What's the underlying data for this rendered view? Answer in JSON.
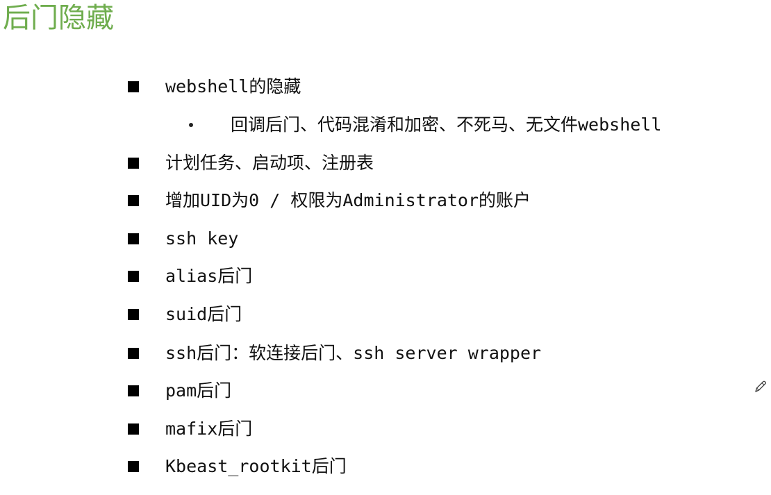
{
  "slide": {
    "title": "后门隐藏",
    "items": [
      {
        "text": "webshell的隐藏"
      },
      {
        "text": "计划任务、启动项、注册表"
      },
      {
        "text": "增加UID为0 / 权限为Administrator的账户"
      },
      {
        "text": "ssh key"
      },
      {
        "text": "alias后门"
      },
      {
        "text": "suid后门"
      },
      {
        "text": "ssh后门：软连接后门、ssh server wrapper"
      },
      {
        "text": "pam后门"
      },
      {
        "text": "mafix后门"
      },
      {
        "text": "Kbeast_rootkit后门"
      }
    ],
    "subitems": [
      {
        "text": "回调后门、代码混淆和加密、不死马、无文件webshell"
      }
    ]
  },
  "icons": {
    "edit": "pencil-icon"
  },
  "colors": {
    "title": "#6fad4e",
    "text": "#111111",
    "bullet": "#000000"
  }
}
